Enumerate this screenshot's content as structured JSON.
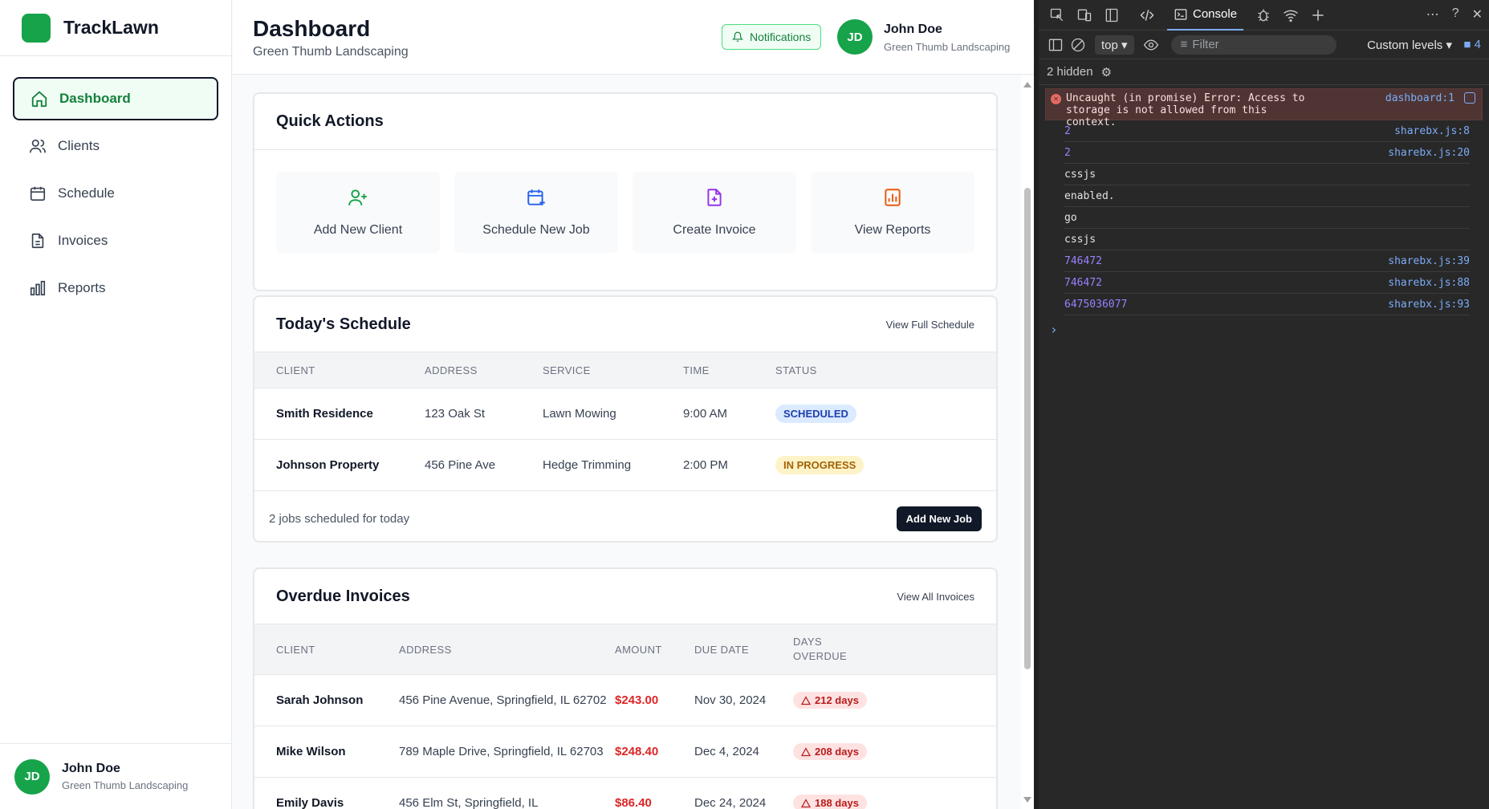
{
  "app": {
    "brand": "TrackLawn",
    "nav": [
      {
        "label": "Dashboard",
        "icon": "home-icon",
        "active": true
      },
      {
        "label": "Clients",
        "icon": "users-icon"
      },
      {
        "label": "Schedule",
        "icon": "calendar-icon"
      },
      {
        "label": "Invoices",
        "icon": "file-icon"
      },
      {
        "label": "Reports",
        "icon": "bar-chart-icon"
      }
    ],
    "user": {
      "initials": "JD",
      "name": "John Doe",
      "org": "Green Thumb Landscaping"
    }
  },
  "header": {
    "title": "Dashboard",
    "subtitle": "Green Thumb Landscaping",
    "notifications_label": "Notifications"
  },
  "quick_actions": {
    "title": "Quick Actions",
    "items": [
      {
        "label": "Add New Client",
        "icon": "user-plus-icon",
        "color": "#16a34a"
      },
      {
        "label": "Schedule New Job",
        "icon": "calendar-plus-icon",
        "color": "#2563eb"
      },
      {
        "label": "Create Invoice",
        "icon": "file-plus-icon",
        "color": "#9333ea"
      },
      {
        "label": "View Reports",
        "icon": "bar-chart-icon",
        "color": "#ea580c"
      }
    ]
  },
  "schedule": {
    "title": "Today's Schedule",
    "view_all": "View Full Schedule",
    "columns": [
      "CLIENT",
      "ADDRESS",
      "SERVICE",
      "TIME",
      "STATUS"
    ],
    "rows": [
      {
        "client": "Smith Residence",
        "address": "123 Oak St",
        "service": "Lawn Mowing",
        "time": "9:00 AM",
        "status": "SCHEDULED"
      },
      {
        "client": "Johnson Property",
        "address": "456 Pine Ave",
        "service": "Hedge Trimming",
        "time": "2:00 PM",
        "status": "IN PROGRESS"
      }
    ],
    "footer_text": "2 jobs scheduled for today",
    "add_button": "Add New Job"
  },
  "overdue": {
    "title": "Overdue Invoices",
    "view_all": "View All Invoices",
    "columns": [
      "CLIENT",
      "ADDRESS",
      "AMOUNT",
      "DUE DATE",
      "DAYS OVERDUE"
    ],
    "rows": [
      {
        "client": "Sarah Johnson",
        "address": "456 Pine Avenue, Springfield, IL 62702",
        "amount": "$243.00",
        "due": "Nov 30, 2024",
        "days": "212 days"
      },
      {
        "client": "Mike Wilson",
        "address": "789 Maple Drive, Springfield, IL 62703",
        "amount": "$248.40",
        "due": "Dec 4, 2024",
        "days": "208 days"
      },
      {
        "client": "Emily Davis",
        "address": "456 Elm St, Springfield, IL",
        "amount": "$86.40",
        "due": "Dec 24, 2024",
        "days": "188 days"
      }
    ]
  },
  "devtools": {
    "console_tab": "Console",
    "context": "top",
    "filter_placeholder": "Filter",
    "levels": "Custom levels",
    "message_count": "4",
    "hidden": "2 hidden",
    "error": {
      "text": "Uncaught (in promise) Error: Access to storage is not allowed from this context.",
      "source": "dashboard:1"
    },
    "logs": [
      {
        "text": "2",
        "source": "sharebx.js:8",
        "kind": "num"
      },
      {
        "text": "2",
        "source": "sharebx.js:20",
        "kind": "num"
      },
      {
        "text": "cssjs",
        "source": "",
        "kind": "txt"
      },
      {
        "text": "enabled.",
        "source": "",
        "kind": "txt"
      },
      {
        "text": "go",
        "source": "",
        "kind": "txt"
      },
      {
        "text": "cssjs",
        "source": "",
        "kind": "txt"
      },
      {
        "text": "746472",
        "source": "sharebx.js:39",
        "kind": "num"
      },
      {
        "text": "746472",
        "source": "sharebx.js:88",
        "kind": "num"
      },
      {
        "text": "6475036077",
        "source": "sharebx.js:93",
        "kind": "num"
      }
    ]
  }
}
